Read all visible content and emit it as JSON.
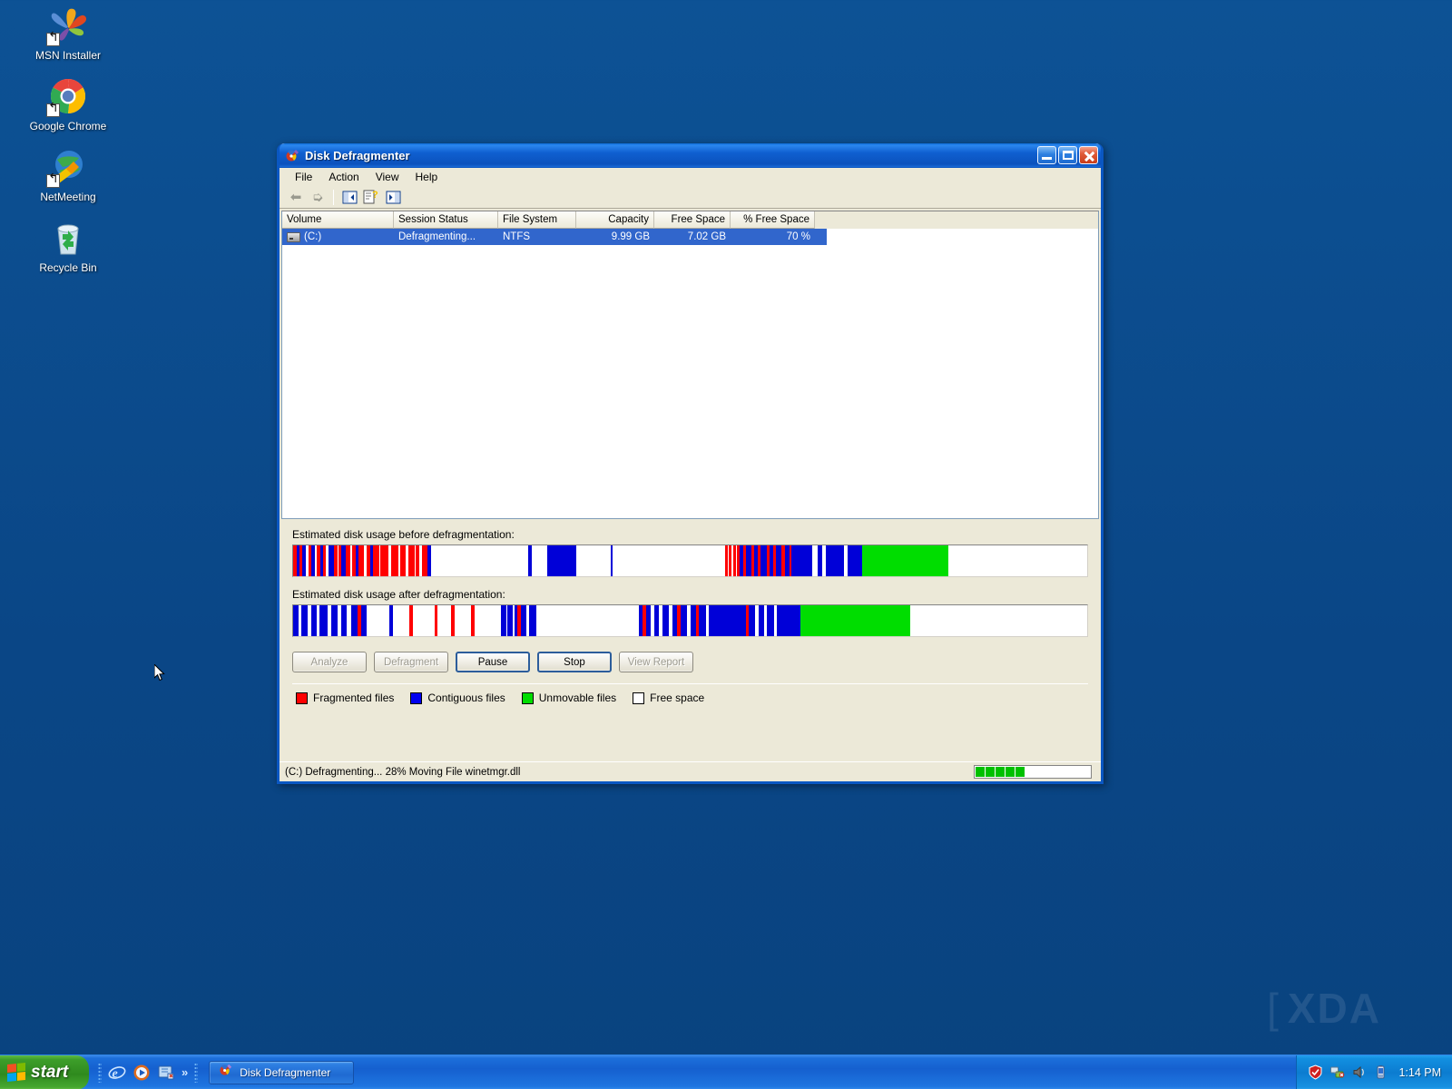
{
  "desktop": {
    "icons": [
      {
        "label": "MSN Installer",
        "icon": "msn-butterfly-icon"
      },
      {
        "label": "Google Chrome",
        "icon": "chrome-icon"
      },
      {
        "label": "NetMeeting",
        "icon": "netmeeting-icon"
      },
      {
        "label": "Recycle Bin",
        "icon": "recycle-bin-icon"
      }
    ]
  },
  "window": {
    "title": "Disk Defragmenter",
    "icon": "disk-defragmenter-icon",
    "controls": {
      "minimize": "Minimize",
      "maximize": "Maximize",
      "close": "Close"
    },
    "menu": [
      "File",
      "Action",
      "View",
      "Help"
    ],
    "toolbar": [
      {
        "name": "back-arrow-icon",
        "label": "Back"
      },
      {
        "name": "forward-arrow-icon",
        "label": "Forward"
      },
      {
        "name": "show-tree-icon",
        "label": "Show/Hide Console Tree"
      },
      {
        "name": "properties-help-icon",
        "label": "Properties"
      },
      {
        "name": "show-pane-icon",
        "label": "Show/Hide Action Pane"
      }
    ],
    "list": {
      "columns": [
        "Volume",
        "Session Status",
        "File System",
        "Capacity",
        "Free Space",
        "% Free Space"
      ],
      "rows": [
        {
          "volume": "(C:)",
          "session_status": "Defragmenting...",
          "file_system": "NTFS",
          "capacity": "9.99 GB",
          "free_space": "7.02 GB",
          "pct_free_space": "70 %",
          "selected": true
        }
      ]
    },
    "graphs": {
      "before_label": "Estimated disk usage before defragmentation:",
      "after_label": "Estimated disk usage after defragmentation:",
      "colors": {
        "fragmented": "#ff0000",
        "contiguous": "#0000d8",
        "unmovable": "#00dd00",
        "free": "#ffffff"
      },
      "before_segments": [
        [
          "#ff0000",
          3
        ],
        [
          "#0000d8",
          2
        ],
        [
          "#ff0000",
          2
        ],
        [
          "#0000d8",
          3
        ],
        [
          "#ffffff",
          2
        ],
        [
          "#ff0000",
          2
        ],
        [
          "#0000d8",
          3
        ],
        [
          "#ffffff",
          1
        ],
        [
          "#ff0000",
          3
        ],
        [
          "#0000d8",
          2
        ],
        [
          "#ff0000",
          2
        ],
        [
          "#ffffff",
          2
        ],
        [
          "#0000d8",
          4
        ],
        [
          "#ff0000",
          3
        ],
        [
          "#ffffff",
          1
        ],
        [
          "#ff0000",
          2
        ],
        [
          "#0000d8",
          3
        ],
        [
          "#ff0000",
          4
        ],
        [
          "#ffffff",
          1
        ],
        [
          "#ff0000",
          3
        ],
        [
          "#0000d8",
          2
        ],
        [
          "#ff0000",
          4
        ],
        [
          "#ffffff",
          2
        ],
        [
          "#ff0000",
          3
        ],
        [
          "#0000d8",
          2
        ],
        [
          "#ff0000",
          5
        ],
        [
          "#ffffff",
          1
        ],
        [
          "#ff0000",
          4
        ],
        [
          "#ff0000",
          2
        ],
        [
          "#ffffff",
          2
        ],
        [
          "#ff0000",
          6
        ],
        [
          "#ffffff",
          1
        ],
        [
          "#ff0000",
          4
        ],
        [
          "#ffffff",
          2
        ],
        [
          "#ff0000",
          5
        ],
        [
          "#ffffff",
          1
        ],
        [
          "#ff0000",
          3
        ],
        [
          "#ffffff",
          2
        ],
        [
          "#ff0000",
          4
        ],
        [
          "#0000d8",
          3
        ],
        [
          "#ffffff",
          74
        ],
        [
          "#0000d8",
          3
        ],
        [
          "#ffffff",
          12
        ],
        [
          "#0000d8",
          22
        ],
        [
          "#ffffff",
          26
        ],
        [
          "#0000d8",
          2
        ],
        [
          "#ffffff",
          86
        ],
        [
          "#ff0000",
          2
        ],
        [
          "#ffffff",
          1
        ],
        [
          "#ff0000",
          2
        ],
        [
          "#ffffff",
          1
        ],
        [
          "#ff0000",
          2
        ],
        [
          "#ffffff",
          1
        ],
        [
          "#ff0000",
          2
        ],
        [
          "#0000d8",
          3
        ],
        [
          "#ff0000",
          2
        ],
        [
          "#0000d8",
          4
        ],
        [
          "#ff0000",
          2
        ],
        [
          "#0000d8",
          3
        ],
        [
          "#ff0000",
          2
        ],
        [
          "#0000d8",
          5
        ],
        [
          "#ff0000",
          2
        ],
        [
          "#0000d8",
          3
        ],
        [
          "#ff0000",
          2
        ],
        [
          "#0000d8",
          4
        ],
        [
          "#ff0000",
          3
        ],
        [
          "#0000d8",
          3
        ],
        [
          "#ff0000",
          2
        ],
        [
          "#0000d8",
          16
        ],
        [
          "#ffffff",
          4
        ],
        [
          "#0000d8",
          3
        ],
        [
          "#ffffff",
          3
        ],
        [
          "#0000d8",
          14
        ],
        [
          "#ffffff",
          3
        ],
        [
          "#0000d8",
          11
        ],
        [
          "#00dd00",
          66
        ],
        [
          "#ffffff",
          106
        ]
      ],
      "after_segments": [
        [
          "#0000d8",
          3
        ],
        [
          "#ffffff",
          2
        ],
        [
          "#0000d8",
          4
        ],
        [
          "#ffffff",
          2
        ],
        [
          "#0000d8",
          3
        ],
        [
          "#ffffff",
          2
        ],
        [
          "#0000d8",
          5
        ],
        [
          "#ffffff",
          2
        ],
        [
          "#0000d8",
          4
        ],
        [
          "#ffffff",
          2
        ],
        [
          "#0000d8",
          3
        ],
        [
          "#ffffff",
          3
        ],
        [
          "#0000d8",
          4
        ],
        [
          "#ff0000",
          2
        ],
        [
          "#0000d8",
          3
        ],
        [
          "#ffffff",
          14
        ],
        [
          "#0000d8",
          2
        ],
        [
          "#ffffff",
          10
        ],
        [
          "#ff0000",
          2
        ],
        [
          "#ffffff",
          13
        ],
        [
          "#ff0000",
          2
        ],
        [
          "#ffffff",
          8
        ],
        [
          "#ff0000",
          2
        ],
        [
          "#ffffff",
          10
        ],
        [
          "#ff0000",
          2
        ],
        [
          "#ffffff",
          16
        ],
        [
          "#0000d8",
          3
        ],
        [
          "#ffffff",
          1
        ],
        [
          "#0000d8",
          3
        ],
        [
          "#ffffff",
          1
        ],
        [
          "#0000d8",
          2
        ],
        [
          "#ff0000",
          2
        ],
        [
          "#0000d8",
          3
        ],
        [
          "#ffffff",
          2
        ],
        [
          "#0000d8",
          4
        ],
        [
          "#ffffff",
          62
        ],
        [
          "#0000d8",
          2
        ],
        [
          "#ff0000",
          2
        ],
        [
          "#0000d8",
          3
        ],
        [
          "#ffffff",
          2
        ],
        [
          "#0000d8",
          3
        ],
        [
          "#ffffff",
          2
        ],
        [
          "#0000d8",
          4
        ],
        [
          "#ffffff",
          2
        ],
        [
          "#0000d8",
          3
        ],
        [
          "#ff0000",
          2
        ],
        [
          "#0000d8",
          4
        ],
        [
          "#ffffff",
          2
        ],
        [
          "#0000d8",
          3
        ],
        [
          "#ff0000",
          2
        ],
        [
          "#0000d8",
          4
        ],
        [
          "#ffffff",
          2
        ],
        [
          "#0000d8",
          22
        ],
        [
          "#ff0000",
          2
        ],
        [
          "#0000d8",
          4
        ],
        [
          "#ffffff",
          2
        ],
        [
          "#0000d8",
          3
        ],
        [
          "#ffffff",
          2
        ],
        [
          "#0000d8",
          4
        ],
        [
          "#ffffff",
          2
        ],
        [
          "#0000d8",
          14
        ],
        [
          "#00dd00",
          66
        ],
        [
          "#ffffff",
          106
        ]
      ]
    },
    "buttons": [
      {
        "label": "Analyze",
        "state": "disabled"
      },
      {
        "label": "Defragment",
        "state": "disabled"
      },
      {
        "label": "Pause",
        "state": "enabled"
      },
      {
        "label": "Stop",
        "state": "enabled"
      },
      {
        "label": "View Report",
        "state": "disabled"
      }
    ],
    "legend": [
      {
        "label": "Fragmented files",
        "color": "#ff0000"
      },
      {
        "label": "Contiguous files",
        "color": "#0000ee"
      },
      {
        "label": "Unmovable files",
        "color": "#00dd00"
      },
      {
        "label": "Free space",
        "color": "#ffffff"
      }
    ],
    "status": {
      "text": "(C:) Defragmenting... 28%  Moving File winetmgr.dll",
      "progress_blocks": 5,
      "progress_color": "#00c000"
    }
  },
  "taskbar": {
    "start_label": "start",
    "quicklaunch": [
      {
        "name": "internet-explorer-icon",
        "label": "Internet Explorer"
      },
      {
        "name": "media-player-icon",
        "label": "Windows Media Player"
      },
      {
        "name": "show-desktop-icon",
        "label": "Show Desktop"
      }
    ],
    "quicklaunch_chevron": "»",
    "tasks": [
      {
        "label": "Disk Defragmenter",
        "icon": "disk-defragmenter-icon",
        "active": true
      }
    ],
    "tray_icons": [
      {
        "name": "security-shield-icon"
      },
      {
        "name": "network-connection-icon"
      },
      {
        "name": "volume-speaker-icon"
      },
      {
        "name": "battery-icon"
      }
    ],
    "clock": "1:14 PM"
  },
  "watermark": {
    "bracket_left": "[",
    "text": "XDA",
    "bracket_right": "]"
  }
}
